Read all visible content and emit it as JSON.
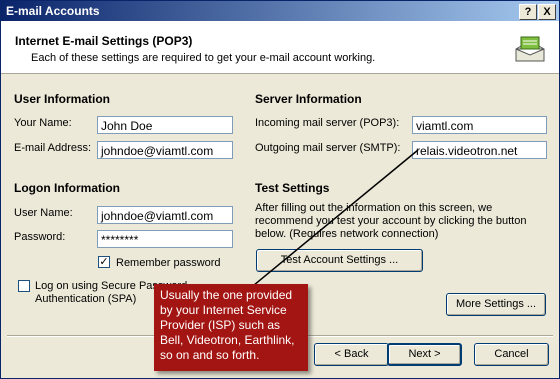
{
  "window": {
    "title": "E-mail Accounts",
    "help_label": "?",
    "close_label": "X"
  },
  "header": {
    "title": "Internet E-mail Settings (POP3)",
    "subtitle": "Each of these settings are required to get your e-mail account working."
  },
  "user_info": {
    "heading": "User Information",
    "name_label": "Your Name:",
    "name_value": "John Doe",
    "email_label": "E-mail Address:",
    "email_value": "johndoe@viamtl.com"
  },
  "server_info": {
    "heading": "Server Information",
    "incoming_label": "Incoming mail server (POP3):",
    "incoming_value": "viamtl.com",
    "outgoing_label": "Outgoing mail server (SMTP):",
    "outgoing_value": "relais.videotron.net"
  },
  "logon_info": {
    "heading": "Logon Information",
    "username_label": "User Name:",
    "username_value": "johndoe@viamtl.com",
    "password_label": "Password:",
    "password_value": "********",
    "remember_label": "Remember password",
    "remember_checked": true,
    "spa_label_line1": "Log on using Secure Password",
    "spa_label_line2": "Authentication (SPA)",
    "spa_checked": false
  },
  "test_settings": {
    "heading": "Test Settings",
    "desc_line1": "After filling out the information on this screen, we",
    "desc_line2": "recommend you test your account by clicking the button",
    "desc_line3": "below. (Requires network connection)",
    "button_label": "Test Account Settings ..."
  },
  "footer": {
    "more_settings": "More Settings ...",
    "back": "< Back",
    "next": "Next >",
    "cancel": "Cancel"
  },
  "callout": {
    "line1": "Usually the one provided",
    "line2": "by your Internet Service",
    "line3": "Provider (ISP) such as",
    "line4": "Bell, Videotron, Earthlink,",
    "line5": "so on and so forth.",
    "color": "#a31512"
  }
}
